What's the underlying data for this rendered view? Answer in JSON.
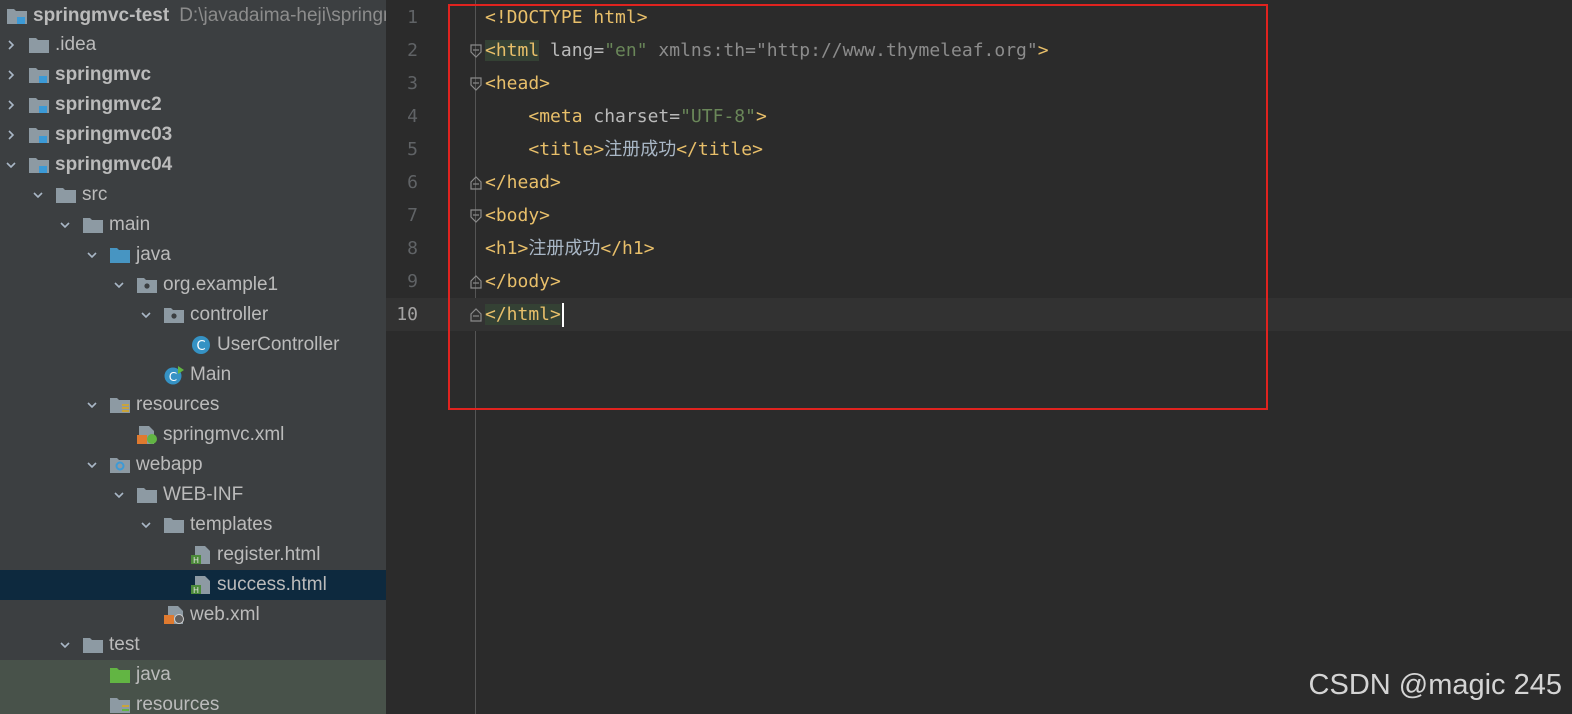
{
  "project_tree": {
    "root": {
      "label": "springmvc-test",
      "path": "D:\\javadaima-heji\\springmvc-test"
    },
    "items": [
      {
        "label": ".idea",
        "depth": 0,
        "arrow": "right",
        "icon": "folder-icon",
        "bold": false
      },
      {
        "label": "springmvc",
        "depth": 0,
        "arrow": "right",
        "icon": "module-icon",
        "bold": true
      },
      {
        "label": "springmvc2",
        "depth": 0,
        "arrow": "right",
        "icon": "module-icon",
        "bold": true
      },
      {
        "label": "springmvc03",
        "depth": 0,
        "arrow": "right",
        "icon": "module-icon",
        "bold": true
      },
      {
        "label": "springmvc04",
        "depth": 0,
        "arrow": "down",
        "icon": "module-icon",
        "bold": true
      },
      {
        "label": "src",
        "depth": 1,
        "arrow": "down",
        "icon": "folder-icon",
        "bold": false
      },
      {
        "label": "main",
        "depth": 2,
        "arrow": "down",
        "icon": "folder-icon",
        "bold": false
      },
      {
        "label": "java",
        "depth": 3,
        "arrow": "down",
        "icon": "source-folder-icon",
        "bold": false
      },
      {
        "label": "org.example1",
        "depth": 4,
        "arrow": "down",
        "icon": "package-icon",
        "bold": false
      },
      {
        "label": "controller",
        "depth": 5,
        "arrow": "down",
        "icon": "package-icon",
        "bold": false
      },
      {
        "label": "UserController",
        "depth": 6,
        "arrow": "none",
        "icon": "java-class-icon",
        "bold": false
      },
      {
        "label": "Main",
        "depth": 5,
        "arrow": "none",
        "icon": "java-main-class-icon",
        "bold": false
      },
      {
        "label": "resources",
        "depth": 3,
        "arrow": "down",
        "icon": "resources-folder-icon",
        "bold": false
      },
      {
        "label": "springmvc.xml",
        "depth": 4,
        "arrow": "none",
        "icon": "spring-xml-icon",
        "bold": false
      },
      {
        "label": "webapp",
        "depth": 3,
        "arrow": "down",
        "icon": "web-folder-icon",
        "bold": false
      },
      {
        "label": "WEB-INF",
        "depth": 4,
        "arrow": "down",
        "icon": "folder-icon",
        "bold": false
      },
      {
        "label": "templates",
        "depth": 5,
        "arrow": "down",
        "icon": "folder-icon",
        "bold": false
      },
      {
        "label": "register.html",
        "depth": 6,
        "arrow": "none",
        "icon": "html-file-icon",
        "bold": false
      },
      {
        "label": "success.html",
        "depth": 6,
        "arrow": "none",
        "icon": "html-file-icon",
        "bold": false,
        "selected": true
      },
      {
        "label": "web.xml",
        "depth": 5,
        "arrow": "none",
        "icon": "web-xml-icon",
        "bold": false
      },
      {
        "label": "test",
        "depth": 2,
        "arrow": "down",
        "icon": "folder-icon",
        "bold": false
      },
      {
        "label": "java",
        "depth": 3,
        "arrow": "none",
        "icon": "test-folder-icon",
        "bold": false,
        "green": true
      },
      {
        "label": "resources",
        "depth": 3,
        "arrow": "none",
        "icon": "test-resources-folder-icon",
        "bold": false,
        "green": true
      }
    ]
  },
  "editor": {
    "current_line": 10,
    "lines": [
      {
        "num": "1",
        "fold": "none",
        "tokens": [
          [
            "tg",
            "<!DOCTYPE html>"
          ]
        ]
      },
      {
        "num": "2",
        "fold": "open",
        "tokens": [
          [
            "tg hl",
            "<html"
          ],
          [
            "at",
            " lang="
          ],
          [
            "st",
            "\"en\""
          ],
          [
            "ns2",
            " xmlns:th="
          ],
          [
            "ns2",
            "\"http://www.thymeleaf.org\""
          ],
          [
            "tg",
            ">"
          ]
        ]
      },
      {
        "num": "3",
        "fold": "open",
        "tokens": [
          [
            "tg",
            "<head>"
          ]
        ]
      },
      {
        "num": "4",
        "fold": "none",
        "tokens": [
          [
            "tx",
            "    "
          ],
          [
            "tg",
            "<meta"
          ],
          [
            "at",
            " charset="
          ],
          [
            "st",
            "\"UTF-8\""
          ],
          [
            "tg",
            ">"
          ]
        ]
      },
      {
        "num": "5",
        "fold": "none",
        "tokens": [
          [
            "tx",
            "    "
          ],
          [
            "tg",
            "<title>"
          ],
          [
            "tx",
            "注册成功"
          ],
          [
            "tg",
            "</title>"
          ]
        ]
      },
      {
        "num": "6",
        "fold": "close",
        "tokens": [
          [
            "tg",
            "</head>"
          ]
        ]
      },
      {
        "num": "7",
        "fold": "open",
        "tokens": [
          [
            "tg",
            "<body>"
          ]
        ]
      },
      {
        "num": "8",
        "fold": "none",
        "tokens": [
          [
            "tg",
            "<h1>"
          ],
          [
            "tx",
            "注册成功"
          ],
          [
            "tg",
            "</h1>"
          ]
        ]
      },
      {
        "num": "9",
        "fold": "close",
        "tokens": [
          [
            "tg",
            "</body>"
          ]
        ]
      },
      {
        "num": "10",
        "fold": "close",
        "tokens": [
          [
            "tg hl",
            "</html>"
          ]
        ]
      }
    ]
  },
  "watermark": "CSDN @magic 245",
  "colors": {
    "tree_bg": "#3c3f41",
    "editor_bg": "#2b2b2b",
    "selection": "#0d293e",
    "annotation_box": "#e0231f"
  }
}
